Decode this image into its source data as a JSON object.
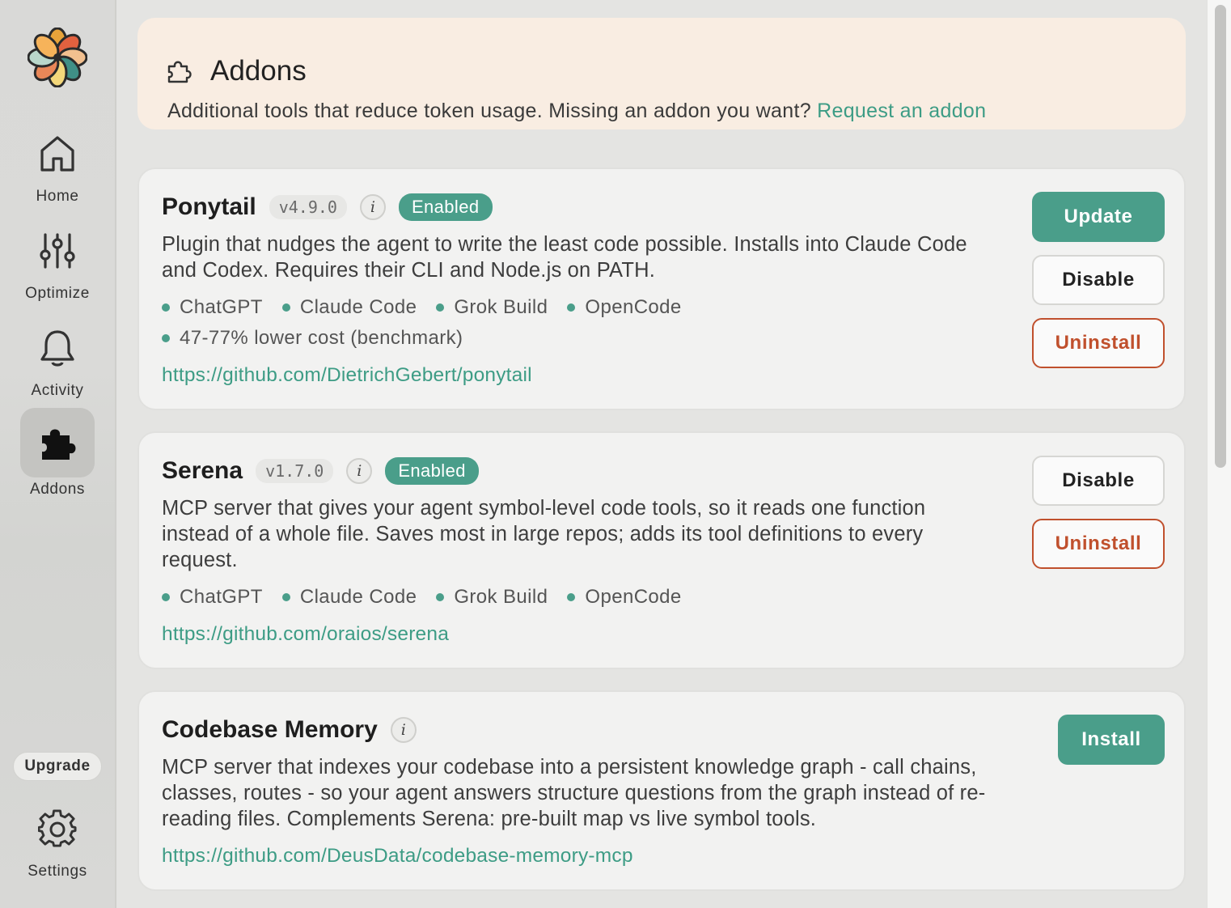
{
  "sidebar": {
    "nav": [
      {
        "label": "Home",
        "icon": "home-icon"
      },
      {
        "label": "Optimize",
        "icon": "sliders-icon"
      },
      {
        "label": "Activity",
        "icon": "bell-icon"
      },
      {
        "label": "Addons",
        "icon": "puzzle-icon",
        "active": true
      }
    ],
    "upgrade_label": "Upgrade",
    "settings_label": "Settings"
  },
  "header": {
    "title": "Addons",
    "description": "Additional tools that reduce token usage. Missing an addon you want?",
    "request_link": "Request an addon"
  },
  "addons": [
    {
      "name": "Ponytail",
      "version": "v4.9.0",
      "info": "i",
      "status": "Enabled",
      "description": "Plugin that nudges the agent to write the least code possible. Installs into Claude Code and Codex. Requires their CLI and Node.js on PATH.",
      "tags": [
        "ChatGPT",
        "Claude Code",
        "Grok Build",
        "OpenCode"
      ],
      "benchmark": "47-77% lower cost (benchmark)",
      "url": "https://github.com/DietrichGebert/ponytail",
      "buttons": {
        "update": "Update",
        "disable": "Disable",
        "uninstall": "Uninstall"
      }
    },
    {
      "name": "Serena",
      "version": "v1.7.0",
      "info": "i",
      "status": "Enabled",
      "description": "MCP server that gives your agent symbol-level code tools, so it reads one function instead of a whole file. Saves most in large repos; adds its tool definitions to every request.",
      "tags": [
        "ChatGPT",
        "Claude Code",
        "Grok Build",
        "OpenCode"
      ],
      "url": "https://github.com/oraios/serena",
      "buttons": {
        "disable": "Disable",
        "uninstall": "Uninstall"
      }
    },
    {
      "name": "Codebase Memory",
      "info": "i",
      "description": "MCP server that indexes your codebase into a persistent knowledge graph - call chains, classes, routes - so your agent answers structure questions from the graph instead of re-reading files. Complements Serena: pre-built map vs live symbol tools.",
      "url": "https://github.com/DeusData/codebase-memory-mcp",
      "buttons": {
        "install": "Install"
      }
    }
  ],
  "colors": {
    "accent": "#4a9e8a",
    "danger": "#c0502d",
    "header_bg": "#f9ede2"
  }
}
